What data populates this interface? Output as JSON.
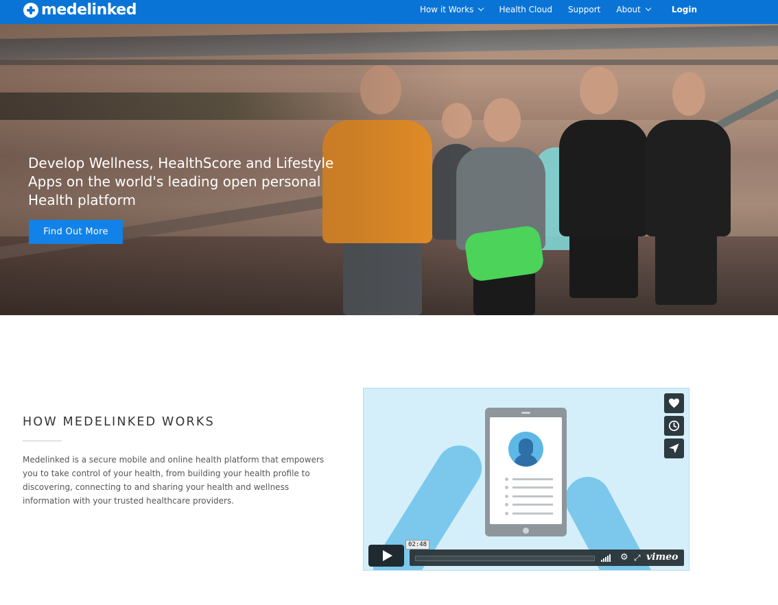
{
  "brand": {
    "name": "medelinked"
  },
  "nav": {
    "items": [
      {
        "label": "How it Works",
        "has_dropdown": true
      },
      {
        "label": "Health Cloud",
        "has_dropdown": false
      },
      {
        "label": "Support",
        "has_dropdown": false
      },
      {
        "label": "About",
        "has_dropdown": true
      }
    ],
    "login_label": "Login"
  },
  "hero": {
    "headline_lines": [
      "Develop Wellness, HealthScore and Lifestyle",
      "Apps on the world's leading open personal",
      "Health platform"
    ],
    "cta_label": "Find Out More"
  },
  "how_it_works": {
    "title": "HOW MEDELINKED WORKS",
    "body": "Medelinked is a secure mobile and online health platform that empowers you to take control of your health, from building your health profile to discovering, connecting to and sharing your health and wellness information with your trusted healthcare providers."
  },
  "video": {
    "duration": "02:48",
    "provider": "vimeo",
    "side_buttons": [
      "heart-icon",
      "clock-icon",
      "send-icon"
    ]
  },
  "colors": {
    "nav_bg": "#0a74d6",
    "cta_bg": "#1282e8",
    "video_bg": "#d5effa",
    "illustration_blue": "#7cc8ec",
    "player_dark": "#1f2a30"
  }
}
